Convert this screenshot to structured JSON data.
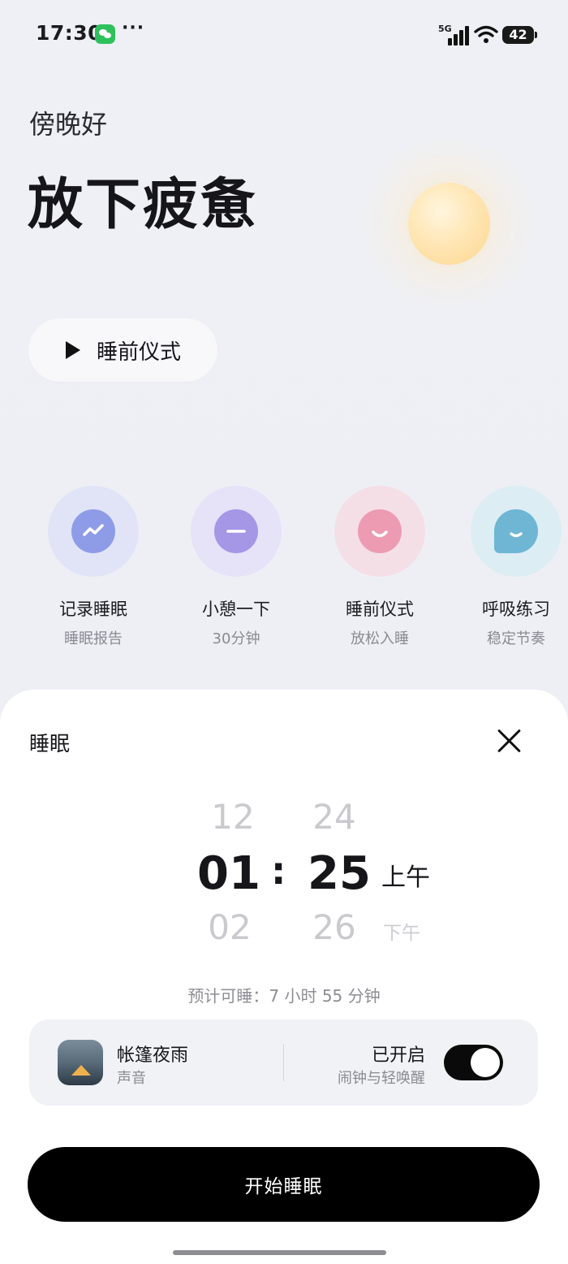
{
  "status_bar": {
    "time": "17:30",
    "more": "···",
    "network": "5G",
    "battery": "42",
    "icons": [
      "wechat-icon",
      "signal-icon",
      "wifi-icon",
      "battery-icon"
    ]
  },
  "hero": {
    "greeting": "傍晚好",
    "headline": "放下疲惫",
    "ritual_button": "睡前仪式"
  },
  "quick_actions": [
    {
      "title": "记录睡眠",
      "subtitle": "睡眠报告",
      "icon": "chart-line-icon",
      "color": "#8e9ce8"
    },
    {
      "title": "小憩一下",
      "subtitle": "30分钟",
      "icon": "minus-icon",
      "color": "#a596e6"
    },
    {
      "title": "睡前仪式",
      "subtitle": "放松入睡",
      "icon": "smile-icon",
      "color": "#ec9bb3"
    },
    {
      "title": "呼吸练习",
      "subtitle": "稳定节奏",
      "icon": "chat-bubble-icon",
      "color": "#6fb6d4"
    }
  ],
  "sheet": {
    "title": "睡眠",
    "picker": {
      "hour_prev": "12",
      "hour": "01",
      "hour_next": "02",
      "separator": ":",
      "minute_prev": "24",
      "minute": "25",
      "minute_next": "26",
      "ampm_selected": "上午",
      "ampm_other": "下午"
    },
    "estimate": "预计可睡：7 小时 55 分钟",
    "sound": {
      "title": "帐篷夜雨",
      "subtitle": "声音"
    },
    "alarm": {
      "title": "已开启",
      "subtitle": "闹钟与轻唤醒",
      "enabled": true
    },
    "start_button": "开始睡眠"
  },
  "colors": {
    "background": "#eeeff5",
    "accent": "#000000",
    "sun": "#fcd791"
  }
}
